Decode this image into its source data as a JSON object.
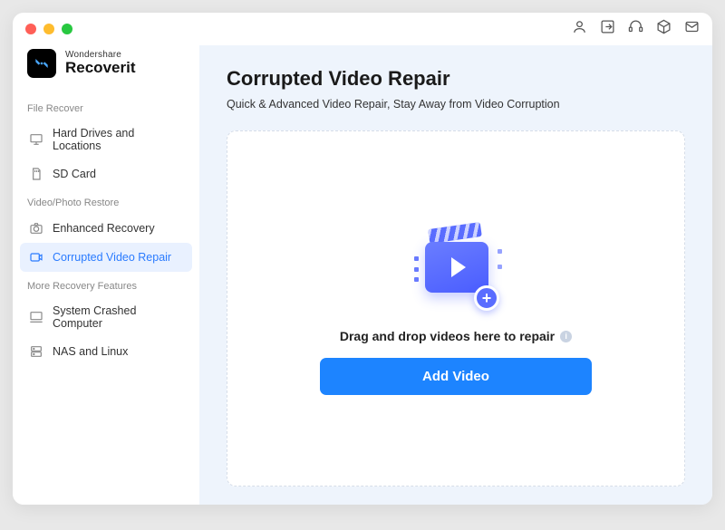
{
  "brand": {
    "small": "Wondershare",
    "big": "Recoverit"
  },
  "sidebar": {
    "sections": [
      {
        "label": "File Recover",
        "items": [
          {
            "name": "hard-drives",
            "label": "Hard Drives and Locations",
            "icon": "monitor"
          },
          {
            "name": "sd-card",
            "label": "SD Card",
            "icon": "sdcard"
          }
        ]
      },
      {
        "label": "Video/Photo Restore",
        "items": [
          {
            "name": "enhanced-recovery",
            "label": "Enhanced Recovery",
            "icon": "camera"
          },
          {
            "name": "corrupted-video-repair",
            "label": "Corrupted Video Repair",
            "icon": "repair",
            "active": true
          }
        ]
      },
      {
        "label": "More Recovery Features",
        "items": [
          {
            "name": "system-crashed",
            "label": "System Crashed Computer",
            "icon": "desktop"
          },
          {
            "name": "nas-linux",
            "label": "NAS and Linux",
            "icon": "server"
          }
        ]
      }
    ]
  },
  "main": {
    "title": "Corrupted Video Repair",
    "subtitle": "Quick & Advanced Video Repair, Stay Away from Video Corruption",
    "drop_text": "Drag and drop videos here to repair",
    "add_button": "Add Video"
  },
  "colors": {
    "accent": "#1d84ff",
    "illustration": "#5a6dff"
  }
}
